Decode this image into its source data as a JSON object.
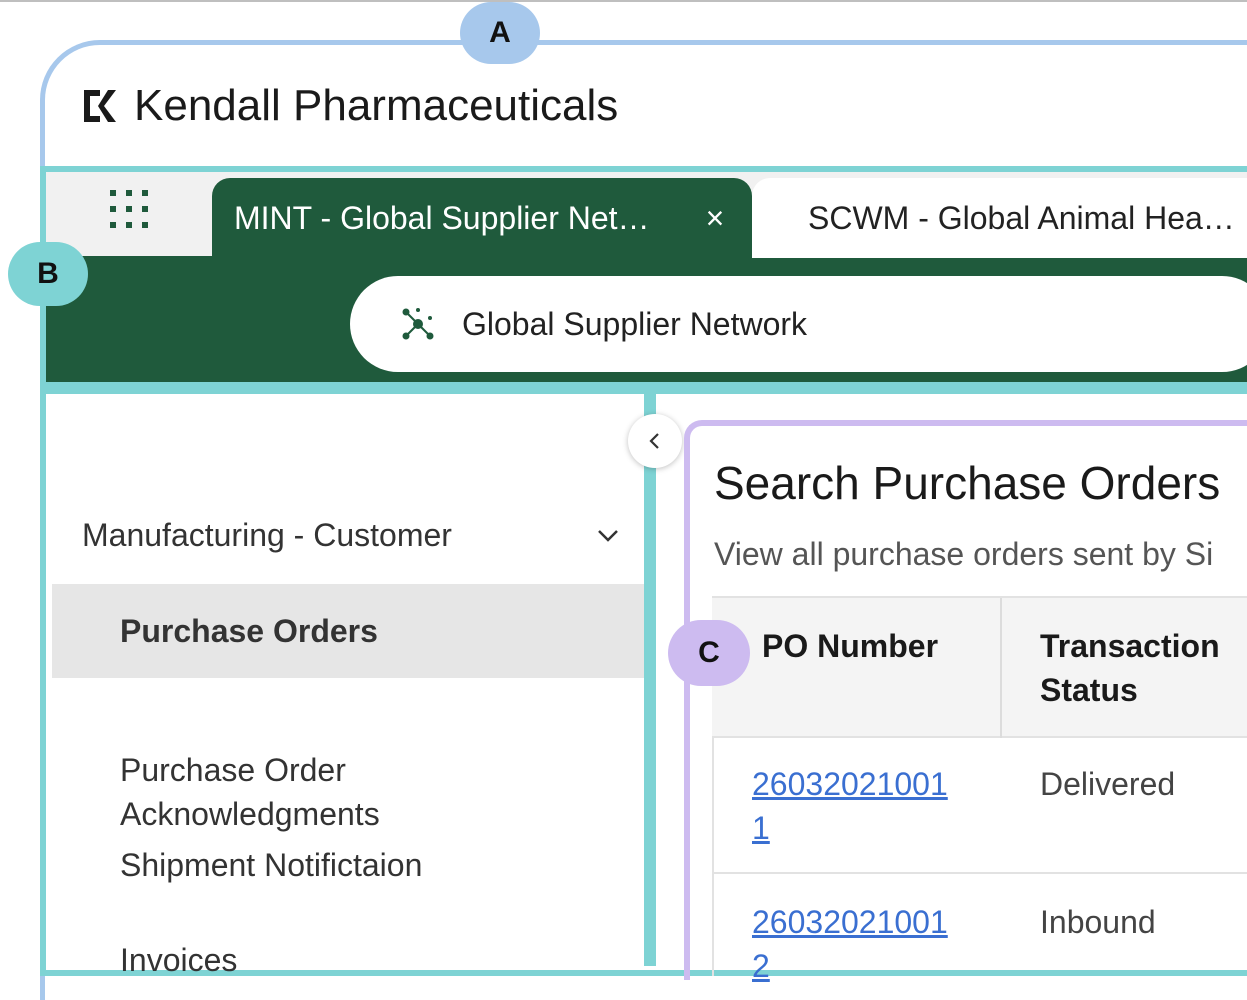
{
  "annotations": {
    "a": "A",
    "b": "B",
    "c": "C"
  },
  "brand": {
    "name": "Kendall Pharmaceuticals"
  },
  "tabs": [
    {
      "label": "MINT - Global Supplier Net…",
      "active": true,
      "close": "×"
    },
    {
      "label": "SCWM - Global Animal Hea…",
      "active": false
    }
  ],
  "search": {
    "label": "Global Supplier Network"
  },
  "sidebar": {
    "section": "Manufacturing - Customer",
    "items": [
      {
        "label": "Purchase Orders",
        "active": true
      },
      {
        "label": "Purchase Order\nAcknowledgments",
        "active": false
      },
      {
        "label": "Shipment Notifictaion",
        "active": false
      },
      {
        "label": "Invoices",
        "active": false
      }
    ]
  },
  "main": {
    "title": "Search Purchase Orders",
    "description": "View all purchase orders sent by Si",
    "table": {
      "columns": [
        "PO Number",
        "Transaction\nStatus"
      ],
      "rows": [
        {
          "po": "260320210011",
          "status": "Delivered"
        },
        {
          "po": "260320210012",
          "status": "Inbound"
        }
      ]
    }
  },
  "colors": {
    "frame_a": "#a7c8ec",
    "frame_b": "#7ed3d4",
    "frame_c": "#cdbbf0",
    "brand_green": "#1f5a3c",
    "link": "#3a6fd1"
  }
}
